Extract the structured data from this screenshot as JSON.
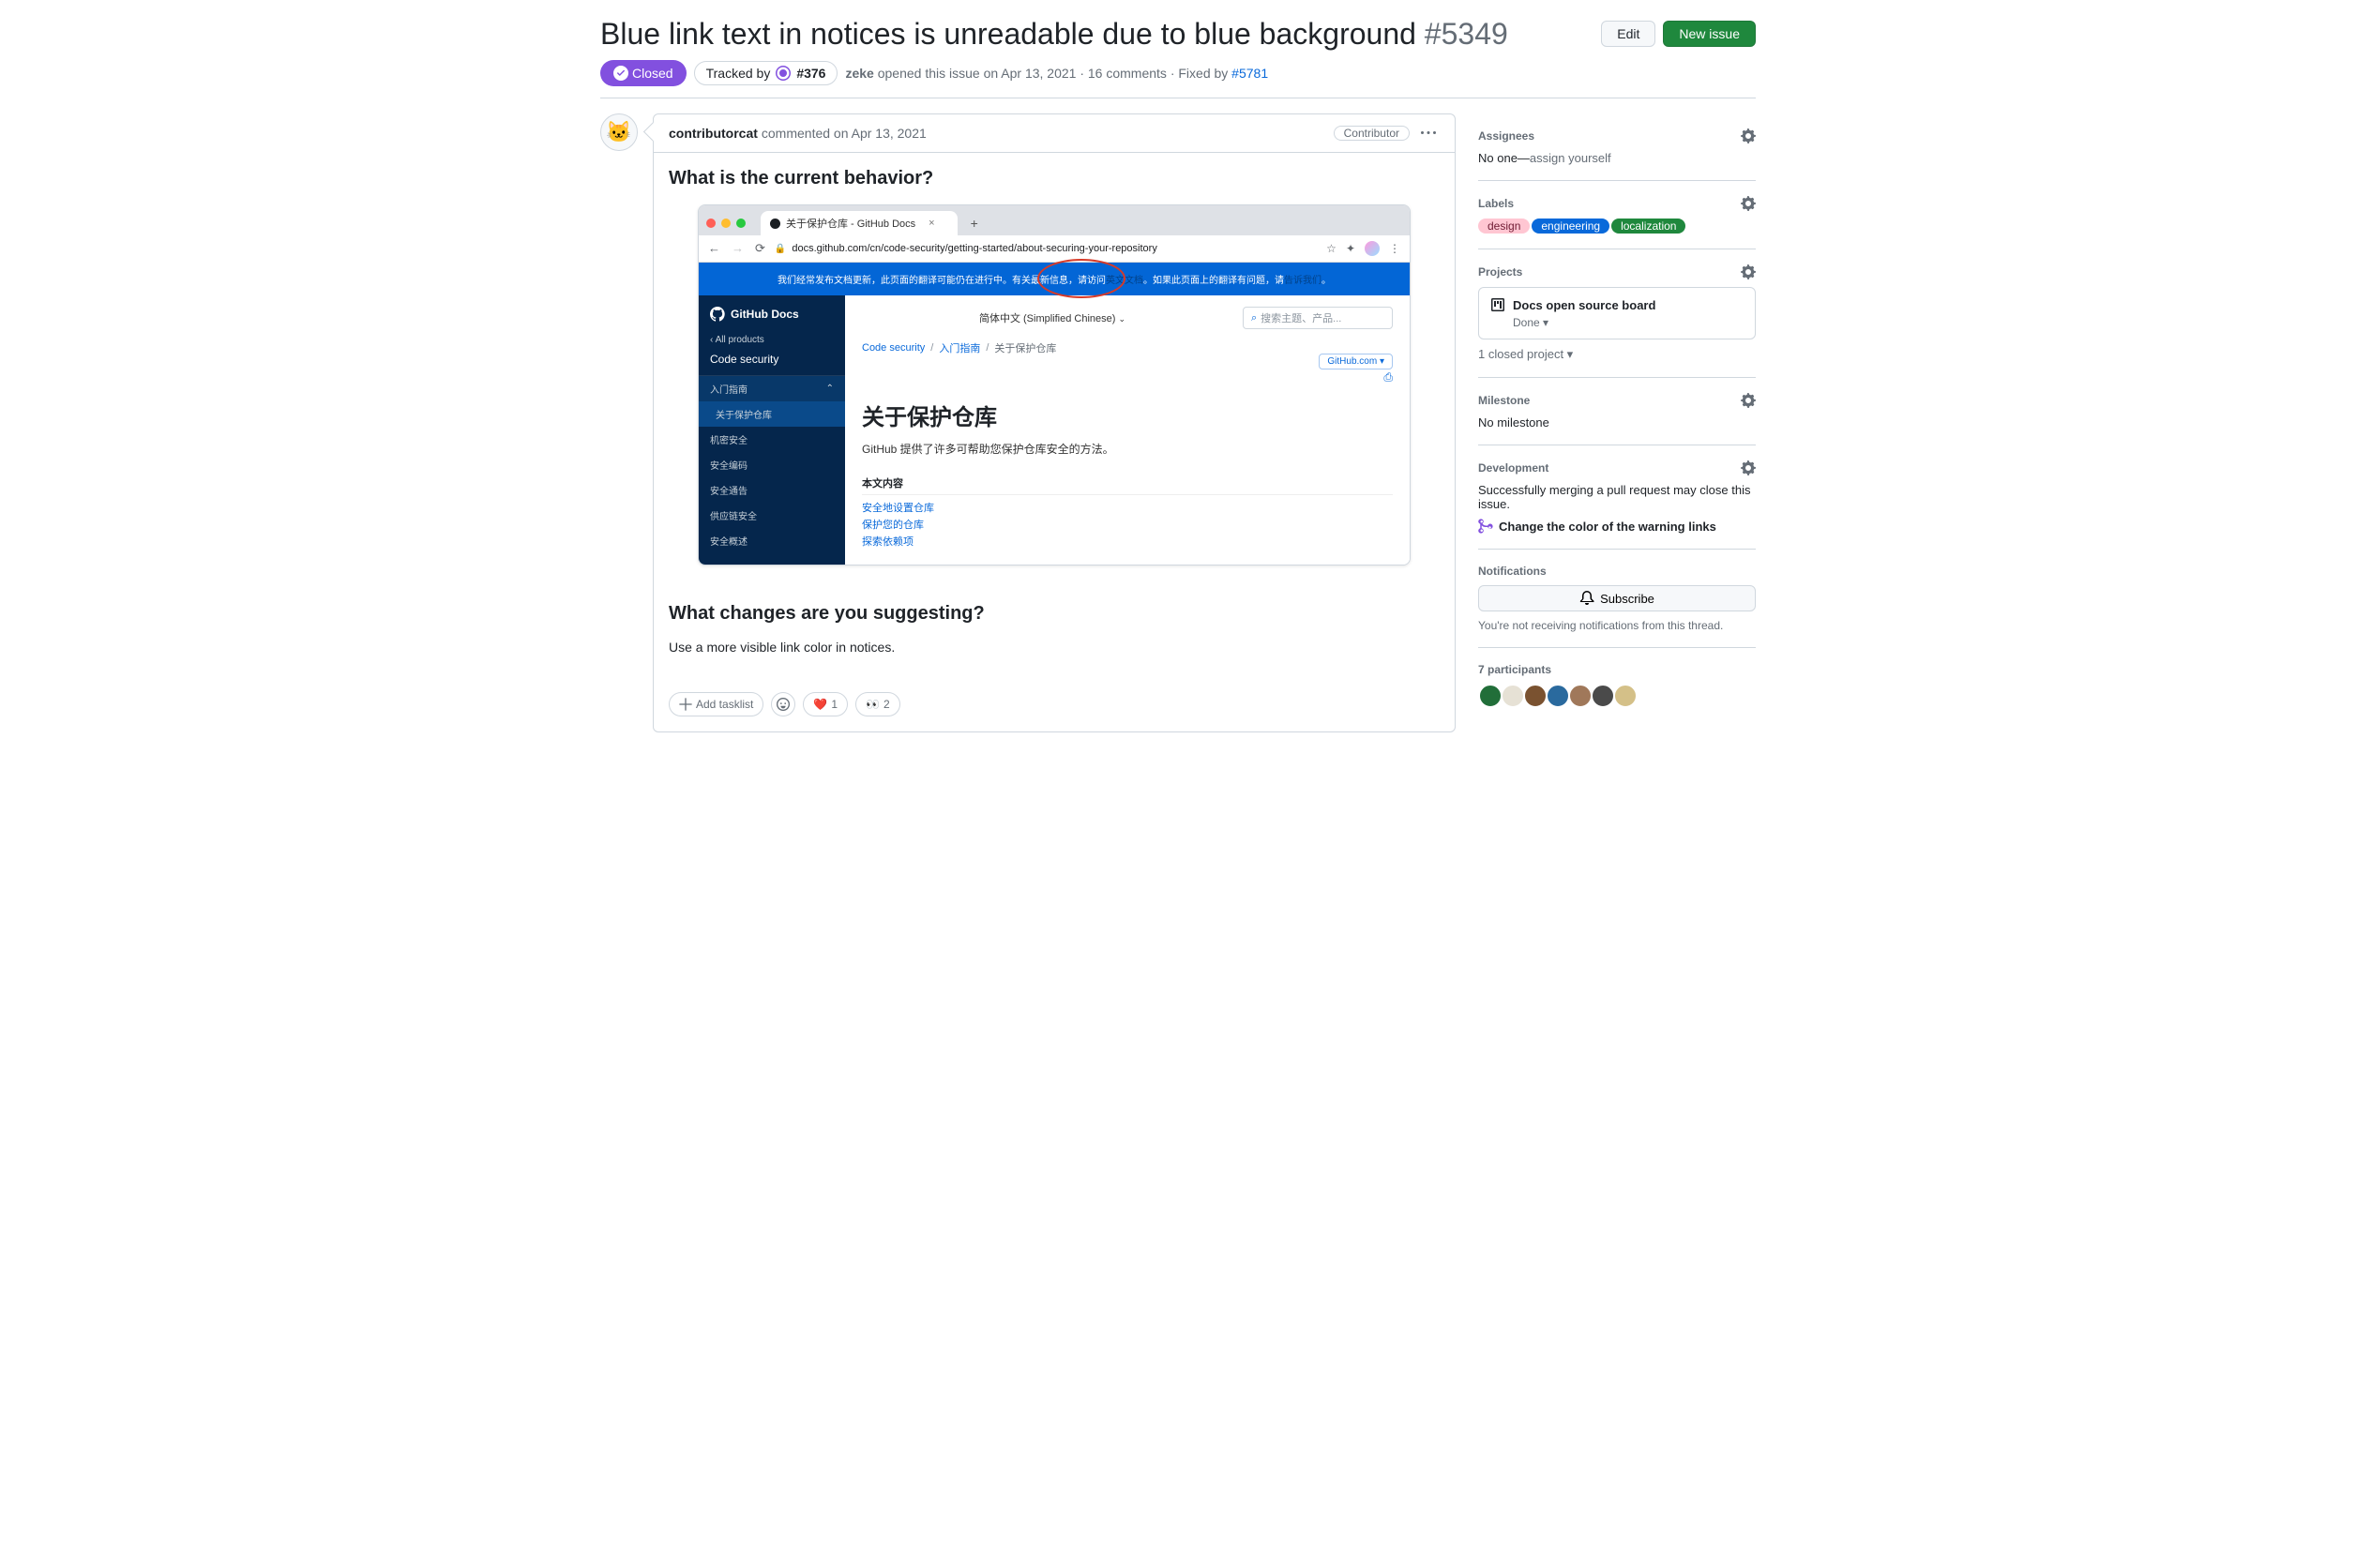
{
  "header": {
    "title": "Blue link text in notices is unreadable due to blue background",
    "number": "#5349",
    "edit": "Edit",
    "new_issue": "New issue"
  },
  "meta": {
    "state": "Closed",
    "tracked_by": "Tracked by",
    "tracked_num": "#376",
    "author": "zeke",
    "opened": "opened this issue on Apr 13, 2021 · 16 comments · Fixed by",
    "fixed_link": "#5781"
  },
  "comment": {
    "author": "contributorcat",
    "action": "commented on Apr 13, 2021",
    "role": "Contributor",
    "h1": "What is the current behavior?",
    "h2": "What changes are you suggesting?",
    "p2": "Use a more visible link color in notices.",
    "add_tasklist": "Add tasklist",
    "react_heart": "1",
    "react_eyes": "2"
  },
  "screenshot": {
    "tab_title": "关于保护仓库 - GitHub Docs",
    "url": "docs.github.com/cn/code-security/getting-started/about-securing-your-repository",
    "banner_pre": "我们经常发布文档更新，此页面的翻译可能仍在进行中。有关最新信息，请访问",
    "banner_link1": "英文文档",
    "banner_mid": "。如果此页面上的翻译有问题，请",
    "banner_link2": "告诉我们",
    "banner_end": "。",
    "logo": "GitHub Docs",
    "back": "All products",
    "section": "Code security",
    "nav1": "入门指南",
    "nav1a": "关于保护仓库",
    "nav2": "机密安全",
    "nav3": "安全编码",
    "nav4": "安全通告",
    "nav5": "供应链安全",
    "nav6": "安全概述",
    "lang": "简体中文 (Simplified Chinese)",
    "search_ph": "搜索主题、产品...",
    "crumb1": "Code security",
    "crumb2": "入门指南",
    "crumb3": "关于保护仓库",
    "ghcom": "GitHub.com",
    "page_h1": "关于保护仓库",
    "page_desc": "GitHub 提供了许多可帮助您保护仓库安全的方法。",
    "toc_h": "本文内容",
    "toc1": "安全地设置仓库",
    "toc2": "保护您的仓库",
    "toc3": "探索依赖项"
  },
  "sidebar": {
    "assignees_title": "Assignees",
    "assignees_none1": "No one—",
    "assignees_none2": "assign yourself",
    "labels_title": "Labels",
    "labels": [
      {
        "name": "design",
        "bg": "#ffc6d2",
        "fg": "#6e1a33"
      },
      {
        "name": "engineering",
        "bg": "#0969da",
        "fg": "#ffffff"
      },
      {
        "name": "localization",
        "bg": "#1f883d",
        "fg": "#ffffff"
      }
    ],
    "projects_title": "Projects",
    "project_name": "Docs open source board",
    "project_status": "Done",
    "closed_projects": "1 closed project",
    "milestone_title": "Milestone",
    "milestone_none": "No milestone",
    "dev_title": "Development",
    "dev_text": "Successfully merging a pull request may close this issue.",
    "pr_title": "Change the color of the warning links",
    "notif_title": "Notifications",
    "subscribe": "Subscribe",
    "notif_text": "You're not receiving notifications from this thread.",
    "participants_title": "7 participants",
    "participant_colors": [
      "#216e39",
      "#e6e1d5",
      "#7a5230",
      "#2a6a9e",
      "#a0785a",
      "#4a4a4a",
      "#d4c088"
    ]
  }
}
